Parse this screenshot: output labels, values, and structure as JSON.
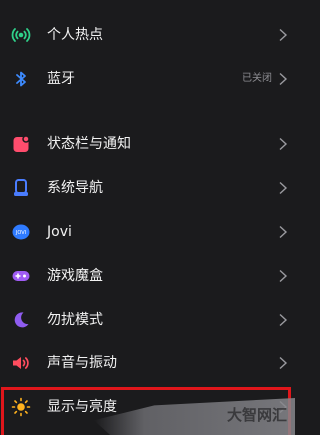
{
  "settings": {
    "items": [
      {
        "label": "个人热点",
        "value": "",
        "icon": "hotspot-icon",
        "color": "#2fd08a"
      },
      {
        "label": "蓝牙",
        "value": "已关闭",
        "icon": "bluetooth-icon",
        "color": "#3d8bff"
      },
      {
        "label": "状态栏与通知",
        "value": "",
        "icon": "notification-icon",
        "color": "#ff4d6d"
      },
      {
        "label": "系统导航",
        "value": "",
        "icon": "navigation-icon",
        "color": "#4a7dff"
      },
      {
        "label": "Jovi",
        "value": "",
        "icon": "jovi-icon",
        "color": "#2f7bff"
      },
      {
        "label": "游戏魔盒",
        "value": "",
        "icon": "game-box-icon",
        "color": "#a05cf5"
      },
      {
        "label": "勿扰模式",
        "value": "",
        "icon": "moon-icon",
        "color": "#8f5cf0"
      },
      {
        "label": "声音与振动",
        "value": "",
        "icon": "speaker-icon",
        "color": "#ff4d5e"
      },
      {
        "label": "显示与亮度",
        "value": "",
        "icon": "sun-icon",
        "color": "#ffb21e"
      }
    ]
  },
  "jovi_badge": "JOVI",
  "watermark": "大智网汇",
  "highlight_color": "#e0161b"
}
